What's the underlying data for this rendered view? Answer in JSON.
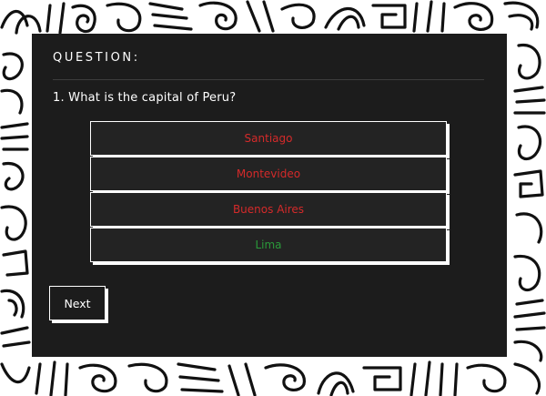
{
  "quiz": {
    "header": "QUESTION:",
    "question": "1. What is the capital of Peru?",
    "answers": [
      {
        "label": "Santiago",
        "state": "wrong"
      },
      {
        "label": "Montevideo",
        "state": "wrong"
      },
      {
        "label": "Buenos Aires",
        "state": "wrong"
      },
      {
        "label": "Lima",
        "state": "correct"
      }
    ],
    "next_label": "Next"
  },
  "colors": {
    "card_background": "#1c1c1c",
    "wrong_answer": "#d42a2a",
    "correct_answer": "#2a9a3a",
    "page_pattern_ink": "#111111",
    "page_pattern_paper": "#ffffff"
  }
}
